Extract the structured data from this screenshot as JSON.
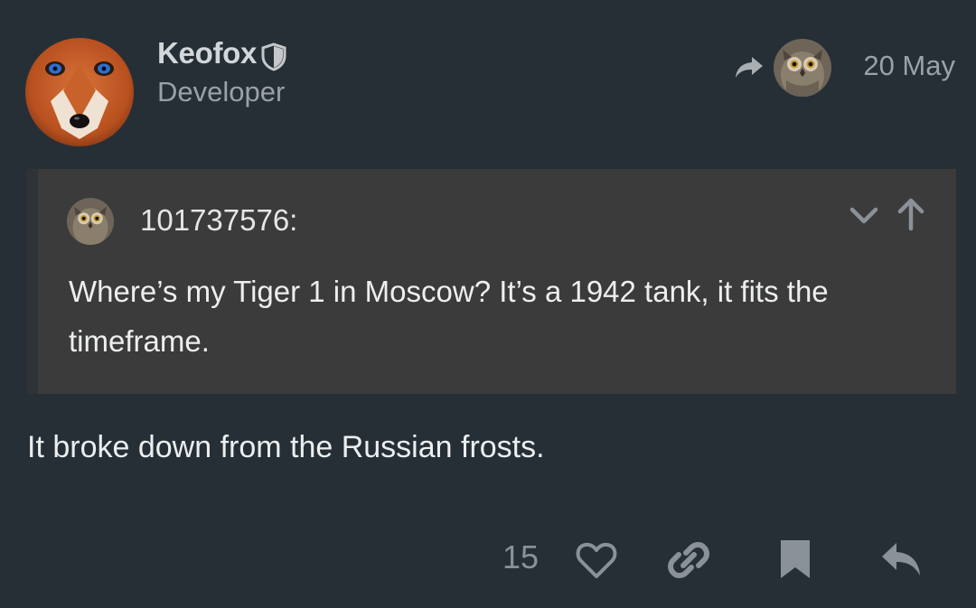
{
  "author": {
    "name": "Keofox",
    "role": "Developer",
    "avatar": "fox-avatar",
    "badge_icon": "shield-icon"
  },
  "meta": {
    "date": "20 May",
    "share_icon": "share-arrow-icon",
    "reply_to_avatar": "owl-avatar"
  },
  "quote": {
    "username": "101737576:",
    "text": "Where’s my Tiger 1 in Moscow? It’s a 1942 tank, it fits the timeframe.",
    "expand_icon": "chevron-down-icon",
    "jump_icon": "arrow-up-icon",
    "avatar": "owl-avatar"
  },
  "post": {
    "body": "It broke down from the Russian frosts."
  },
  "actions": {
    "like_count": "15",
    "icons": [
      "heart-icon",
      "link-icon",
      "bookmark-icon",
      "reply-icon"
    ]
  },
  "colors": {
    "background": "#262f35",
    "quote_background": "#3b3b3b",
    "muted_text": "#9aa1a7",
    "action_icon": "#8a9198"
  }
}
